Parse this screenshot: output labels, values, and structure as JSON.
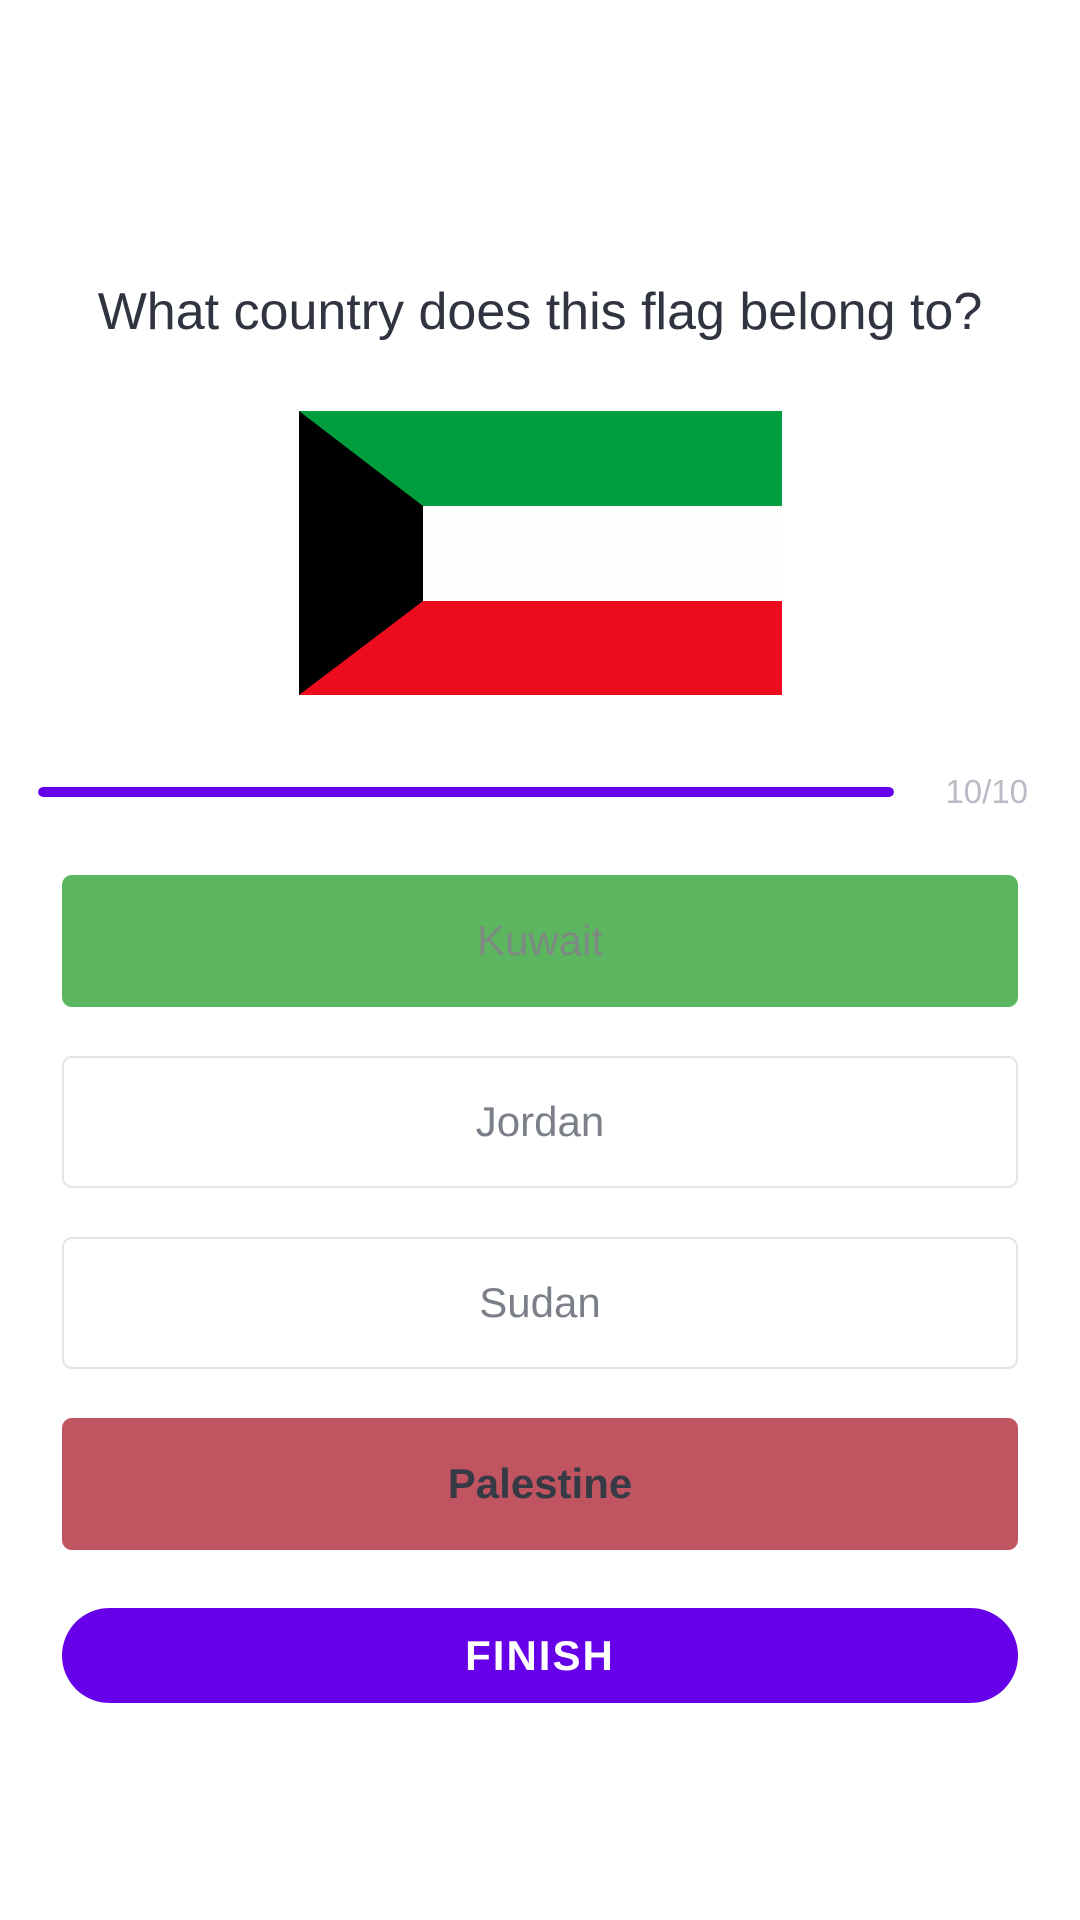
{
  "quiz": {
    "question": "What country does this flag belong to?",
    "flag": {
      "name": "kuwait-flag",
      "colors": {
        "green": "#009e3d",
        "white": "#fdfdfb",
        "red": "#ec0c1d",
        "black": "#000000"
      }
    },
    "progress": {
      "label": "10/10",
      "fraction": 1.0
    },
    "answers": [
      {
        "label": "Kuwait",
        "state": "correct"
      },
      {
        "label": "Jordan",
        "state": "neutral"
      },
      {
        "label": "Sudan",
        "state": "neutral"
      },
      {
        "label": "Palestine",
        "state": "wrong"
      }
    ],
    "finish_label": "FINISH"
  },
  "colors": {
    "accent": "#6500e8",
    "correct": "#5cb65f",
    "wrong": "#c15461"
  }
}
